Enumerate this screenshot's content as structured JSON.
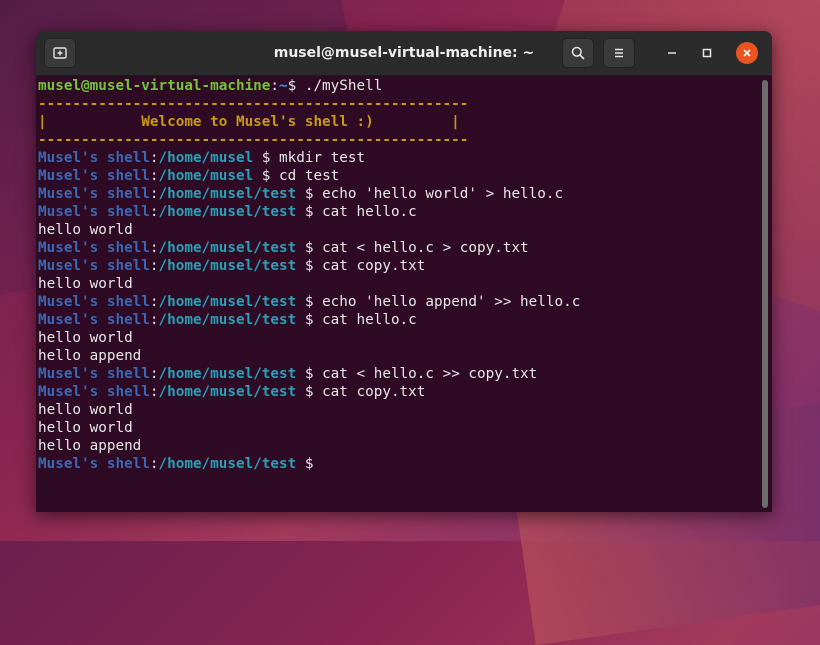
{
  "window": {
    "title": "musel@musel-virtual-machine: ~"
  },
  "prompt": {
    "user_host": "musel@musel-virtual-machine",
    "path": "~",
    "command": "./myShell"
  },
  "banner": {
    "rule": "--------------------------------------------------",
    "welcome": "|           Welcome to Musel's shell :)         |"
  },
  "shell_label": "Musel's shell",
  "lines": [
    {
      "type": "cmd",
      "path": "/home/musel",
      "cmd": "mkdir test"
    },
    {
      "type": "cmd",
      "path": "/home/musel",
      "cmd": "cd test"
    },
    {
      "type": "cmd",
      "path": "/home/musel/test",
      "cmd": "echo 'hello world' > hello.c"
    },
    {
      "type": "cmd",
      "path": "/home/musel/test",
      "cmd": "cat hello.c"
    },
    {
      "type": "out",
      "text": "hello world"
    },
    {
      "type": "cmd",
      "path": "/home/musel/test",
      "cmd": "cat < hello.c > copy.txt"
    },
    {
      "type": "cmd",
      "path": "/home/musel/test",
      "cmd": "cat copy.txt"
    },
    {
      "type": "out",
      "text": "hello world"
    },
    {
      "type": "cmd",
      "path": "/home/musel/test",
      "cmd": "echo 'hello append' >> hello.c"
    },
    {
      "type": "cmd",
      "path": "/home/musel/test",
      "cmd": "cat hello.c"
    },
    {
      "type": "out",
      "text": "hello world"
    },
    {
      "type": "out",
      "text": "hello append"
    },
    {
      "type": "cmd",
      "path": "/home/musel/test",
      "cmd": "cat < hello.c >> copy.txt"
    },
    {
      "type": "cmd",
      "path": "/home/musel/test",
      "cmd": "cat copy.txt"
    },
    {
      "type": "out",
      "text": "hello world"
    },
    {
      "type": "out",
      "text": "hello world"
    },
    {
      "type": "out",
      "text": "hello append"
    },
    {
      "type": "cmd",
      "path": "/home/musel/test",
      "cmd": ""
    }
  ],
  "icons": {
    "new_tab": "new-tab-icon",
    "search": "search-icon",
    "menu": "hamburger-menu-icon",
    "minimize": "minimize-icon",
    "maximize": "maximize-icon",
    "close": "close-icon"
  },
  "colors": {
    "terminal_bg": "#2e0a24",
    "user_green": "#76c43c",
    "path_blue": "#4a8fd9",
    "shell_blue": "#3a68b3",
    "shell_path_cyan": "#2aa0b8",
    "banner_yellow": "#c99a12",
    "close_orange": "#e95420"
  }
}
